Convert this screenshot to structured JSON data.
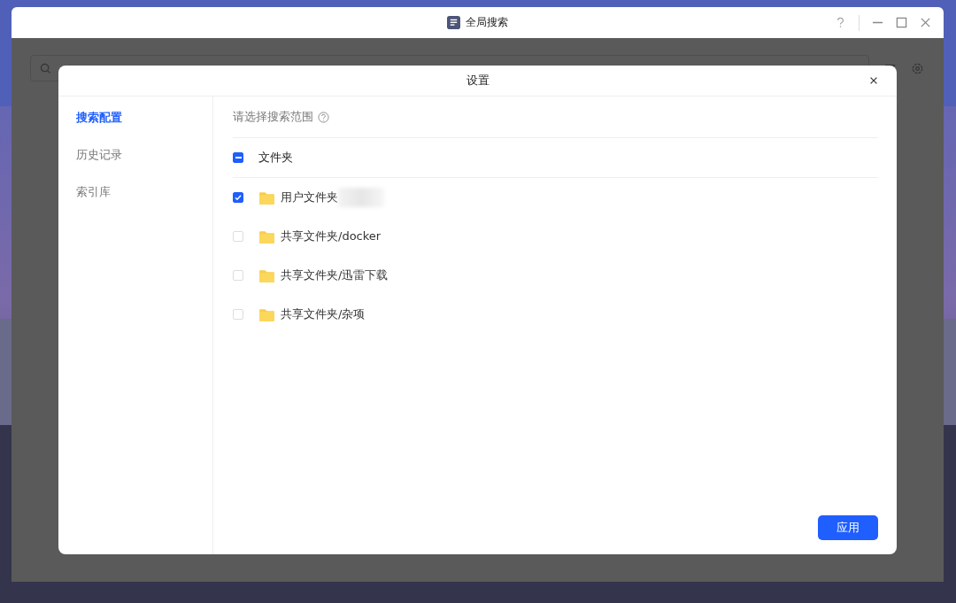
{
  "window": {
    "title": "全局搜索"
  },
  "dialog": {
    "title": "设置",
    "sidebar": {
      "items": [
        {
          "label": "搜索配置",
          "selected": true
        },
        {
          "label": "历史记录",
          "selected": false
        },
        {
          "label": "索引库",
          "selected": false
        }
      ]
    },
    "scope_label": "请选择搜索范围",
    "group": {
      "label": "文件夹",
      "checked": true,
      "partial": true
    },
    "folders": [
      {
        "label": "用户文件夹",
        "checked": true,
        "redacted": true
      },
      {
        "label": "共享文件夹/docker",
        "checked": false,
        "redacted": false
      },
      {
        "label": "共享文件夹/迅雷下载",
        "checked": false,
        "redacted": false
      },
      {
        "label": "共享文件夹/杂项",
        "checked": false,
        "redacted": false
      }
    ],
    "apply_button": "应用"
  }
}
